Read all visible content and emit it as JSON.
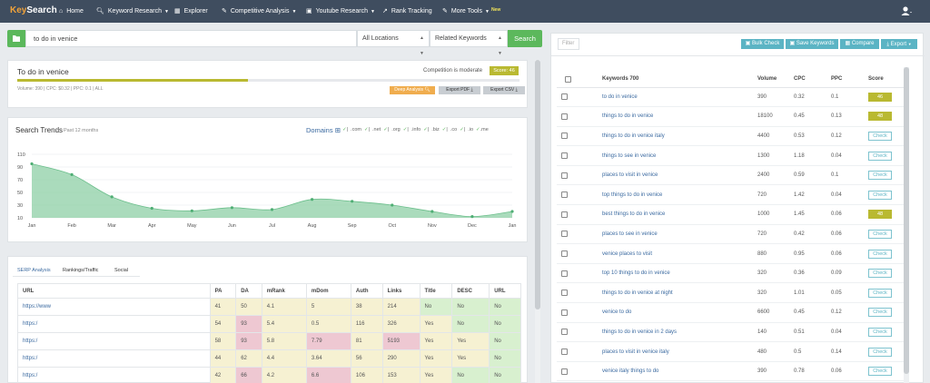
{
  "nav": {
    "logo_key": "Key",
    "logo_rest": "Search",
    "items": [
      {
        "label": "Home",
        "icon": "home-icon"
      },
      {
        "label": "Keyword Research",
        "icon": "search-icon",
        "dropdown": true
      },
      {
        "label": "Explorer",
        "icon": "chart-icon"
      },
      {
        "label": "Competitive Analysis",
        "icon": "wrench-icon",
        "dropdown": true
      },
      {
        "label": "Youtube Research",
        "icon": "video-icon",
        "dropdown": true
      },
      {
        "label": "Rank Tracking",
        "icon": "trend-icon"
      },
      {
        "label": "More Tools",
        "icon": "wrench-icon",
        "dropdown": true,
        "badge": "New"
      }
    ]
  },
  "search": {
    "query": "to do in venice",
    "location": "All Locations",
    "mode": "Related Keywords",
    "button": "Search"
  },
  "kw_card": {
    "title": "To do in venice",
    "competition": "Competition is moderate",
    "score": "Score: 46",
    "progress": 0.46,
    "meta": "Volume: 390 | CPC: $0.32 | PPC: 0.1 | ALL",
    "deep_analysis": "Deep Analysis",
    "export_pdf": "Export PDF",
    "export_csv": "Export CSV"
  },
  "trends": {
    "title": "Search Trends",
    "subtitle": "Past 12 months",
    "domains_label": "Domains",
    "domains": [
      ".com",
      ".net",
      ".org",
      ".info",
      ".biz",
      ".co",
      ".io",
      ".me"
    ]
  },
  "chart_data": {
    "type": "area",
    "categories": [
      "Jan",
      "Feb",
      "Mar",
      "Apr",
      "May",
      "Jun",
      "Jul",
      "Aug",
      "Sep",
      "Oct",
      "Nov",
      "Dec",
      "Jan"
    ],
    "values": [
      95,
      78,
      43,
      25,
      21,
      26,
      23,
      39,
      36,
      30,
      20,
      12,
      20
    ],
    "y_ticks": [
      10,
      30,
      50,
      70,
      90,
      110
    ],
    "ylim": [
      10,
      110
    ],
    "grid": true,
    "color": "#8dcfa6"
  },
  "serp": {
    "tabs": [
      "SERP Analysis",
      "Rankings/Traffic",
      "Social"
    ],
    "columns": [
      "URL",
      "PA",
      "DA",
      "mRank",
      "mDom",
      "Auth",
      "Links",
      "Title",
      "DESC",
      "URL"
    ],
    "rows": [
      [
        "https://www",
        "41",
        "50",
        "4.1",
        "5",
        "38",
        "214",
        "No",
        "No",
        "No"
      ],
      [
        "https:/",
        "54",
        "93",
        "5.4",
        "0.5",
        "116",
        "326",
        "Yes",
        "No",
        "No"
      ],
      [
        "https:/",
        "58",
        "93",
        "5.8",
        "7.79",
        "81",
        "5193",
        "Yes",
        "Yes",
        "No"
      ],
      [
        "https:/",
        "44",
        "62",
        "4.4",
        "3.64",
        "56",
        "290",
        "Yes",
        "Yes",
        "No"
      ],
      [
        "https:/",
        "42",
        "66",
        "4.2",
        "6.6",
        "106",
        "153",
        "Yes",
        "No",
        "No"
      ]
    ]
  },
  "right": {
    "filter_placeholder": "Filter",
    "buttons": [
      "Bulk Check",
      "Save Keywords",
      "Compare",
      "Export"
    ],
    "columns": [
      "Keywords 700",
      "Volume",
      "CPC",
      "PPC",
      "Score"
    ],
    "rows": [
      [
        "to do in venice",
        "390",
        "0.32",
        "0.1",
        "46"
      ],
      [
        "things to do in venice",
        "18100",
        "0.45",
        "0.13",
        "48"
      ],
      [
        "things to do in venice italy",
        "4400",
        "0.53",
        "0.12",
        "Check"
      ],
      [
        "things to see in venice",
        "1300",
        "1.18",
        "0.04",
        "Check"
      ],
      [
        "places to visit in venice",
        "2400",
        "0.59",
        "0.1",
        "Check"
      ],
      [
        "top things to do in venice",
        "720",
        "1.42",
        "0.04",
        "Check"
      ],
      [
        "best things to do in venice",
        "1000",
        "1.45",
        "0.06",
        "48"
      ],
      [
        "places to see in venice",
        "720",
        "0.42",
        "0.06",
        "Check"
      ],
      [
        "venice places to visit",
        "880",
        "0.95",
        "0.06",
        "Check"
      ],
      [
        "top 10 things to do in venice",
        "320",
        "0.36",
        "0.09",
        "Check"
      ],
      [
        "things to do in venice at night",
        "320",
        "1.01",
        "0.05",
        "Check"
      ],
      [
        "venice to do",
        "6600",
        "0.45",
        "0.12",
        "Check"
      ],
      [
        "things to do in venice in 2 days",
        "140",
        "0.51",
        "0.04",
        "Check"
      ],
      [
        "places to visit in venice italy",
        "480",
        "0.5",
        "0.14",
        "Check"
      ],
      [
        "venice italy things to do",
        "390",
        "0.78",
        "0.06",
        "Check"
      ]
    ]
  }
}
